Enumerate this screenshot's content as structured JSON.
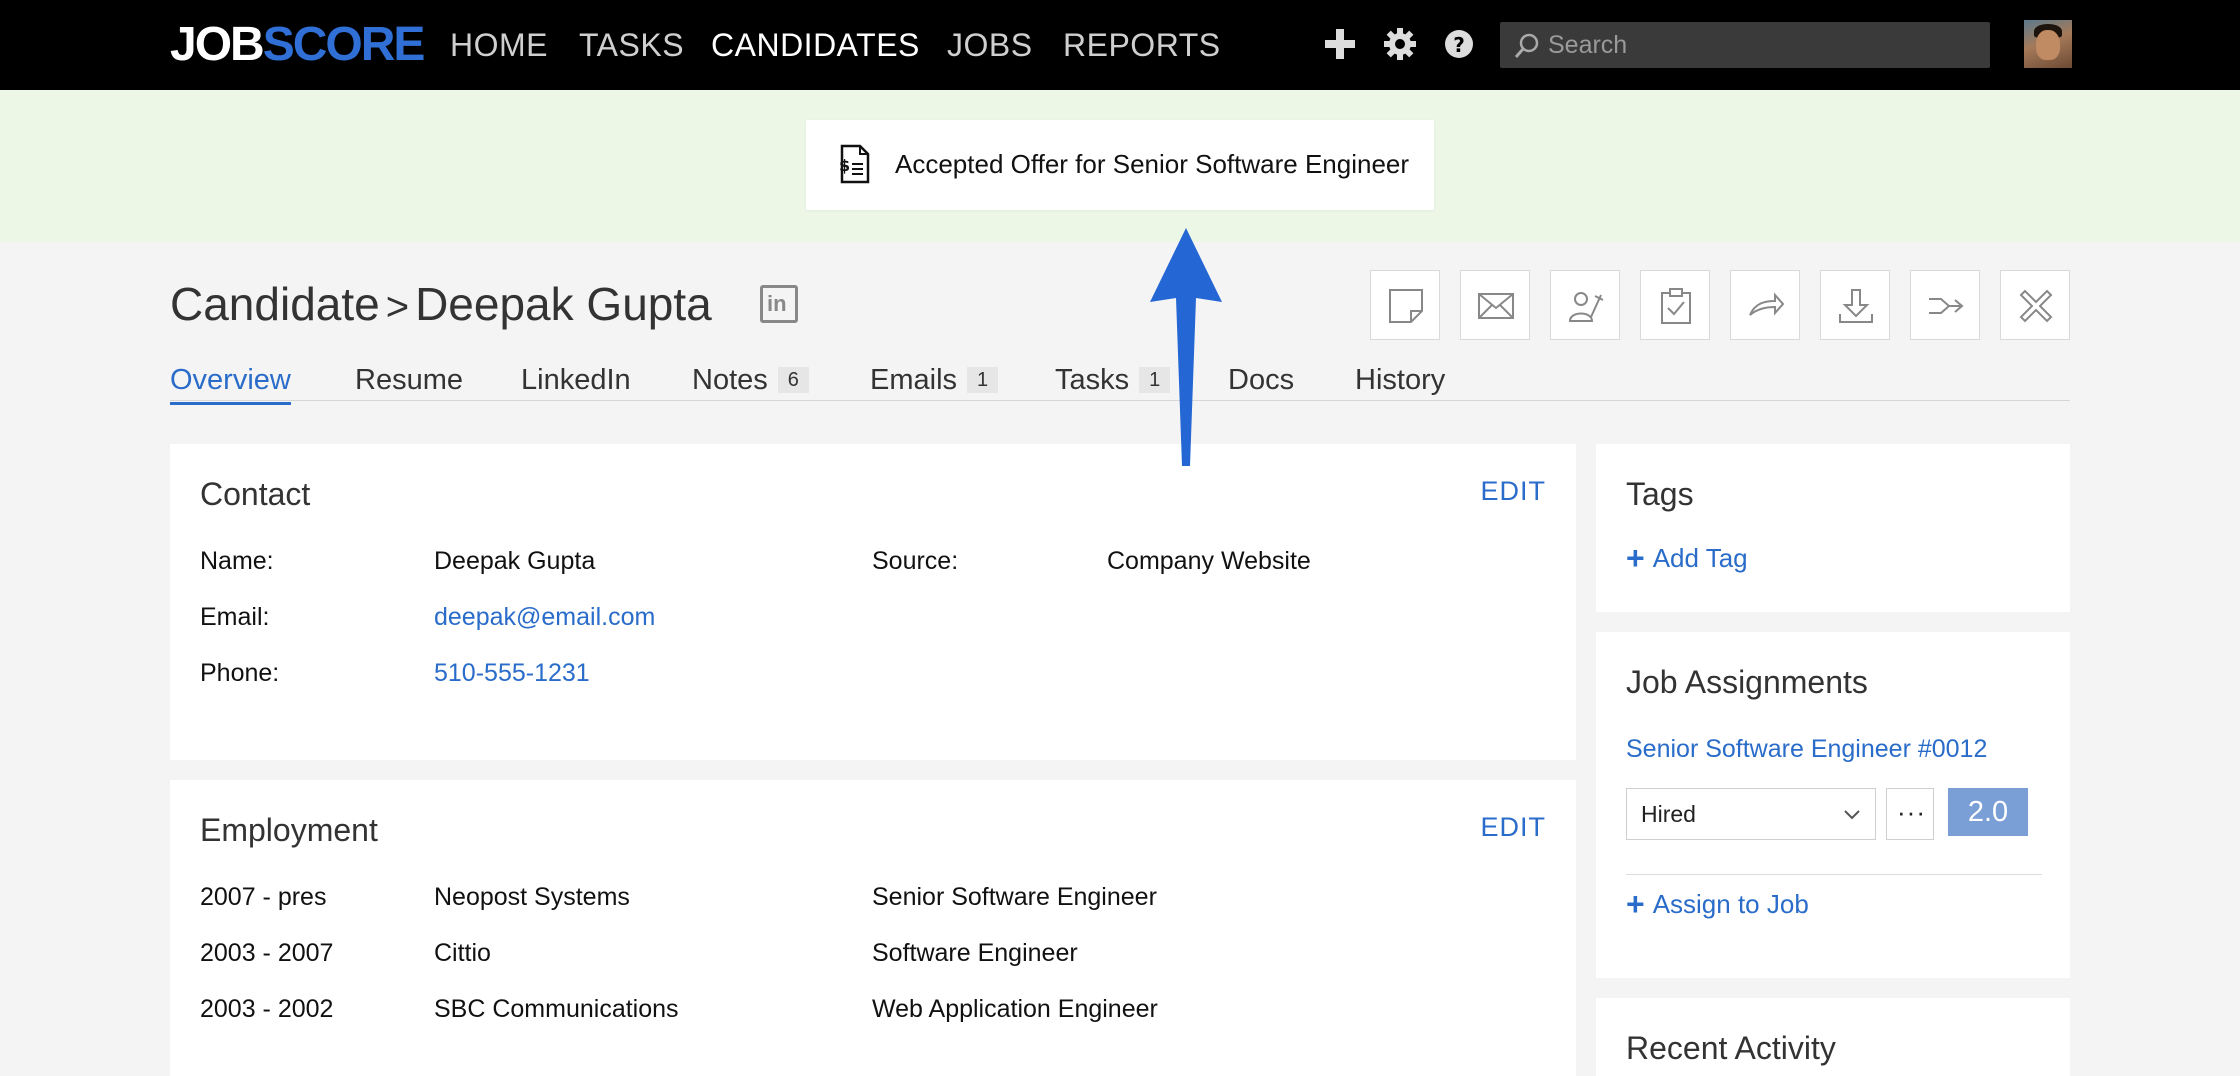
{
  "brand": {
    "logo_part1": "JOB",
    "logo_part2": "SCORE",
    "accent": "#2f6fd6"
  },
  "nav": {
    "items": [
      {
        "label": "HOME",
        "active": false
      },
      {
        "label": "TASKS",
        "active": false
      },
      {
        "label": "CANDIDATES",
        "active": true
      },
      {
        "label": "JOBS",
        "active": false
      },
      {
        "label": "REPORTS",
        "active": false
      }
    ],
    "icons": [
      "plus-icon",
      "gear-icon",
      "help-icon"
    ],
    "search_placeholder": "Search"
  },
  "notification": {
    "message": "Accepted Offer for Senior Software Engineer",
    "icon": "offer-document-icon"
  },
  "header": {
    "section": "Candidate",
    "separator": ">",
    "name": "Deepak Gupta",
    "linkedin_icon_text": "in",
    "actions": [
      "note-icon",
      "email-icon",
      "assign-icon",
      "task-icon",
      "forward-icon",
      "download-icon",
      "merge-icon",
      "close-icon"
    ]
  },
  "tabs": [
    {
      "label": "Overview",
      "count": null
    },
    {
      "label": "Resume",
      "count": null
    },
    {
      "label": "LinkedIn",
      "count": null
    },
    {
      "label": "Notes",
      "count": "6"
    },
    {
      "label": "Emails",
      "count": "1"
    },
    {
      "label": "Tasks",
      "count": "1"
    },
    {
      "label": "Docs",
      "count": null
    },
    {
      "label": "History",
      "count": null
    }
  ],
  "contact": {
    "title": "Contact",
    "edit": "EDIT",
    "name_label": "Name:",
    "name": "Deepak Gupta",
    "email_label": "Email:",
    "email": "deepak@email.com",
    "phone_label": "Phone:",
    "phone": "510-555-1231",
    "source_label": "Source:",
    "source": "Company Website"
  },
  "employment": {
    "title": "Employment",
    "edit": "EDIT",
    "rows": [
      {
        "years": "2007 - pres",
        "company": "Neopost Systems",
        "role": "Senior Software Engineer"
      },
      {
        "years": "2003 - 2007",
        "company": "Cittio",
        "role": "Software Engineer"
      },
      {
        "years": "2003 - 2002",
        "company": "SBC Communications",
        "role": "Web Application Engineer"
      }
    ]
  },
  "tags": {
    "title": "Tags",
    "add": "Add Tag"
  },
  "jobs": {
    "title": "Job Assignments",
    "job": "Senior Software Engineer #0012",
    "status": "Hired",
    "more": "···",
    "score": "2.0",
    "assign": "Assign to Job"
  },
  "recent": {
    "title": "Recent Activity"
  }
}
